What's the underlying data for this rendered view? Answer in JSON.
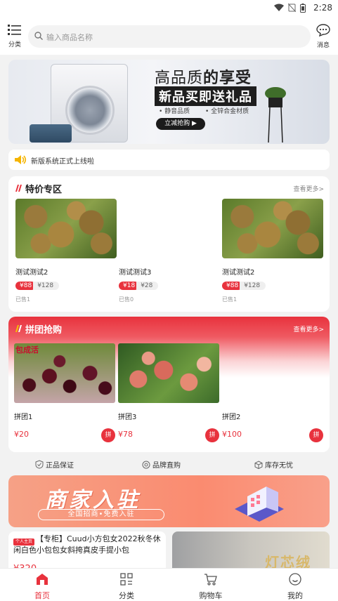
{
  "status": {
    "time": "2:28"
  },
  "header": {
    "category_label": "分类",
    "search_placeholder": "输入商品名称",
    "message_label": "消息"
  },
  "banner": {
    "headline_a": "高品质",
    "headline_b": "的享受",
    "subline": "新品买即送礼品",
    "feature_1": "• 静音品质",
    "feature_2": "• 全锌合金材质",
    "button": "立减抢购 ▶"
  },
  "notice": {
    "text": "新版系统正式上线啦"
  },
  "special": {
    "title": "特价专区",
    "more": "查看更多>",
    "items": [
      {
        "name": "测试测试2",
        "price": "¥88",
        "old_price": "¥128",
        "sold": "已售1"
      },
      {
        "name": "测试测试3",
        "price": "¥18",
        "old_price": "¥28",
        "sold": "已售0"
      },
      {
        "name": "测试测试2",
        "price": "¥88",
        "old_price": "¥128",
        "sold": "已售1"
      }
    ]
  },
  "group": {
    "title": "拼团抢购",
    "more": "查看更多>",
    "image_1_text": "包成活",
    "items": [
      {
        "name": "拼团1",
        "price": "¥20",
        "button": "拼"
      },
      {
        "name": "拼团3",
        "price": "¥78",
        "button": "拼"
      },
      {
        "name": "拼团2",
        "price": "¥100",
        "button": "拼"
      }
    ]
  },
  "guarantee": {
    "item_1": "正品保证",
    "item_2": "品牌直购",
    "item_3": "库存无忧"
  },
  "merchant": {
    "title": "商家入驻",
    "subtitle": "全国招商•免费入驻"
  },
  "product": {
    "tag": "个人主页",
    "title": "【专柜】Cuud小方包女2022秋冬休闲白色小包包女斜挎真皮手提小包",
    "price": "¥320",
    "image_text": "灯芯绒"
  },
  "tabs": [
    {
      "label": "首页",
      "icon": "home-icon",
      "active": true
    },
    {
      "label": "分类",
      "icon": "category-icon",
      "active": false
    },
    {
      "label": "购物车",
      "icon": "cart-icon",
      "active": false
    },
    {
      "label": "我的",
      "icon": "profile-icon",
      "active": false
    }
  ],
  "colors": {
    "accent": "#e8323d",
    "background": "#f2f2f2"
  }
}
